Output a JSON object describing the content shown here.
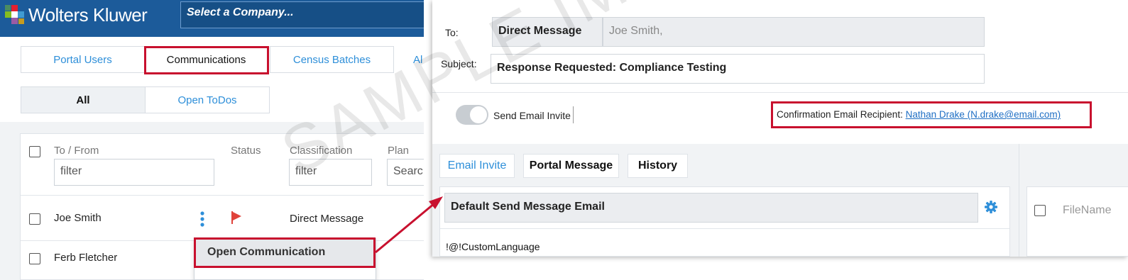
{
  "header": {
    "brand": "Wolters Kluwer",
    "company_placeholder": "Select a Company..."
  },
  "tabs": [
    {
      "label": "Portal Users"
    },
    {
      "label": "Communications"
    },
    {
      "label": "Census Batches"
    },
    {
      "label": "Al"
    }
  ],
  "subtabs": [
    {
      "label": "All"
    },
    {
      "label": "Open ToDos"
    }
  ],
  "grid": {
    "columns": {
      "to_from": "To / From",
      "status": "Status",
      "classification": "Classification",
      "plan": "Plan"
    },
    "filters": {
      "to_from": "filter",
      "classification": "filter",
      "plan": "Searc"
    },
    "rows": [
      {
        "name": "Joe Smith",
        "classification": "Direct Message"
      },
      {
        "name": "Ferb Fletcher",
        "classification": ""
      }
    ]
  },
  "context_menu": {
    "open_label": "Open Communication"
  },
  "message": {
    "to_label": "To:",
    "to_type": "Direct Message",
    "to_value": "Joe Smith,",
    "subject_label": "Subject:",
    "subject_value": "Response Requested: Compliance Testing",
    "send_invite_label": "Send Email Invite",
    "confirmation_label": "Confirmation Email Recipient:",
    "confirmation_value": "Nathan Drake (N.drake@email.com)"
  },
  "message_tabs": [
    {
      "label": "Email Invite"
    },
    {
      "label": "Portal Message"
    },
    {
      "label": "History"
    }
  ],
  "template": {
    "name": "Default Send Message Email",
    "body_preview": "!@!CustomLanguage"
  },
  "side_pane": {
    "column": "FileName"
  },
  "watermark": "SAMPLE IMAGE",
  "colors": {
    "topbar": "#1c5b9a",
    "accent": "#2e8fd9",
    "highlight": "#c8102e",
    "flag": "#e0433b"
  }
}
